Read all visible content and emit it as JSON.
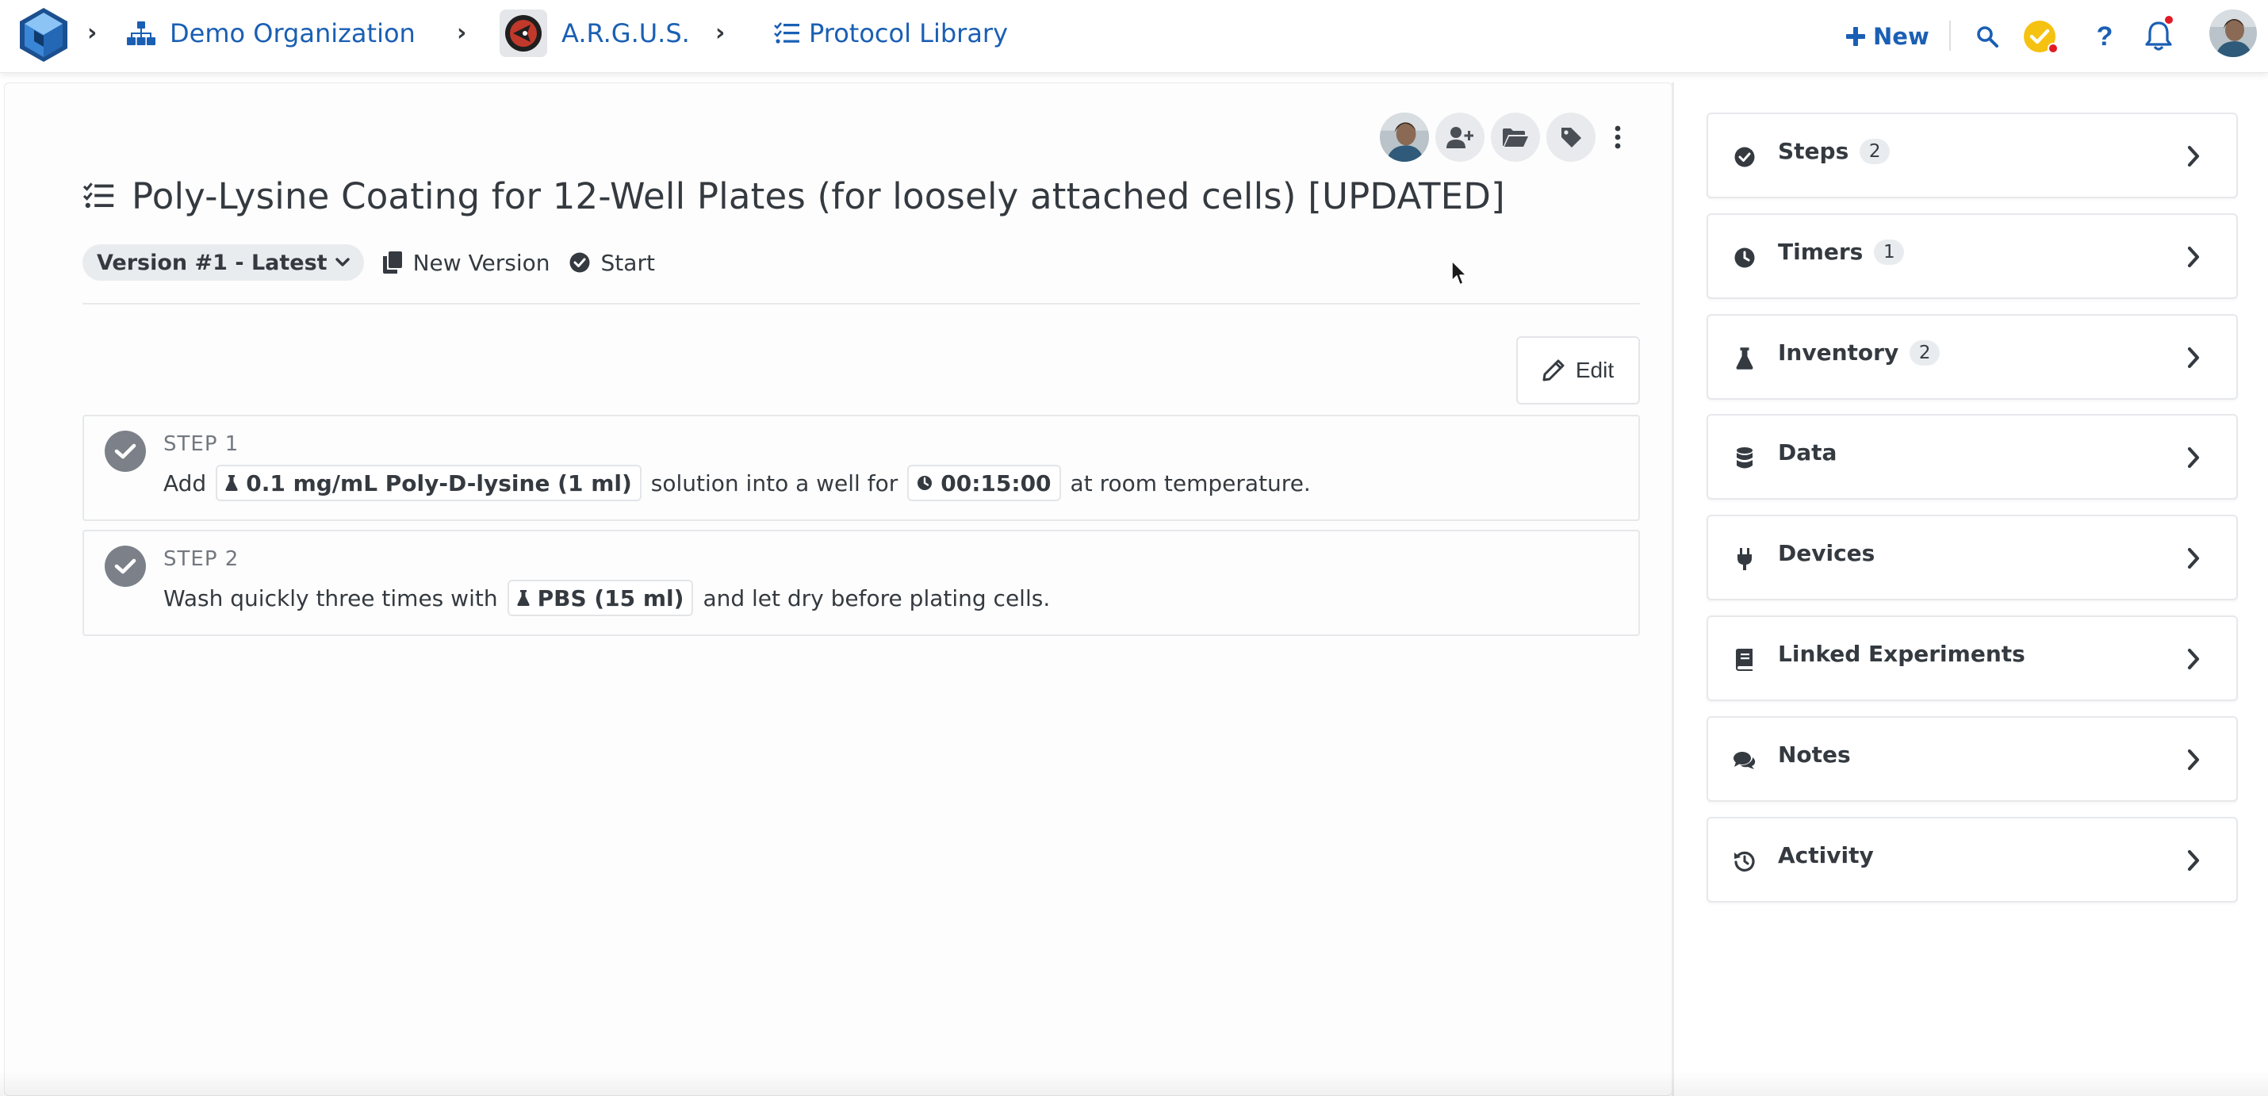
{
  "nav": {
    "org_name": "Demo Organization",
    "project_name": "A.R.G.U.S.",
    "library_name": "Protocol Library",
    "new_label": "New",
    "icons": [
      "app-logo-icon",
      "org-chart-icon",
      "protocol-list-icon",
      "plus-icon",
      "search-icon",
      "tasks-check-icon",
      "help-icon",
      "bell-icon"
    ]
  },
  "protocol": {
    "title": "Poly-Lysine Coating for 12-Well Plates (for loosely attached cells) [UPDATED]",
    "version_label": "Version #1 - Latest",
    "new_version_label": "New Version",
    "start_label": "Start",
    "edit_label": "Edit"
  },
  "steps": [
    {
      "label": "STEP 1",
      "parts": {
        "pre": "Add",
        "inventory_chip": "0.1 mg/mL Poly-D-lysine (1 ml)",
        "mid": "solution into a well for",
        "timer_chip": "00:15:00",
        "post": "at room temperature."
      }
    },
    {
      "label": "STEP 2",
      "parts": {
        "pre": "Wash quickly three times with",
        "inventory_chip": "PBS (15 ml)",
        "post": "and let dry before plating cells."
      }
    }
  ],
  "sidebar": {
    "cards": [
      {
        "label": "Steps",
        "count": "2",
        "icon": "check-circle-icon"
      },
      {
        "label": "Timers",
        "count": "1",
        "icon": "clock-icon"
      },
      {
        "label": "Inventory",
        "count": "2",
        "icon": "flask-icon"
      },
      {
        "label": "Data",
        "icon": "database-icon"
      },
      {
        "label": "Devices",
        "icon": "plug-icon"
      },
      {
        "label": "Linked Experiments",
        "icon": "book-icon"
      },
      {
        "label": "Notes",
        "icon": "comments-icon"
      },
      {
        "label": "Activity",
        "icon": "history-icon"
      }
    ]
  },
  "colors": {
    "link_blue": "#1a5fb4",
    "text_dark": "#343a40",
    "check_gray": "#7c8189",
    "notif_red": "#e01b24",
    "task_yellow": "#f5c211"
  }
}
